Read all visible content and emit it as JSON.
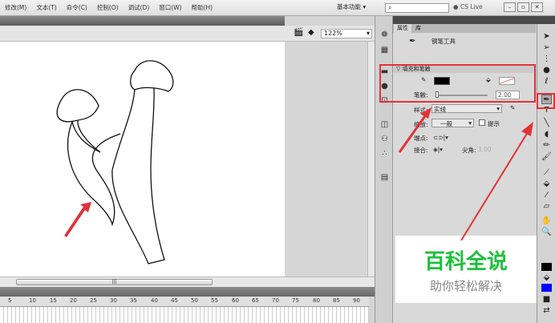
{
  "menu": [
    "修改(M)",
    "文本(T)",
    "命令(C)",
    "控制(O)",
    "调试(D)",
    "窗口(W)",
    "帮助(H)"
  ],
  "workspace": "基本功能 ▾",
  "search_placeholder": "",
  "cs_live": "CS Live",
  "zoom": "122%",
  "timeline_ticks": [
    "5",
    "10",
    "15",
    "20",
    "25",
    "30",
    "35",
    "40",
    "45",
    "50",
    "55",
    "60",
    "65",
    "70",
    "75",
    "80",
    "85",
    "90"
  ],
  "panel": {
    "tabs": [
      "属性",
      "库"
    ],
    "tool_name": "钢笔工具",
    "section": "填充和笔触",
    "stroke_label": "笔触:",
    "stroke_value": "2.00",
    "style_label": "样式:",
    "style_value": "实线",
    "scale_label": "缩放:",
    "scale_value": "一般",
    "hint_label": "提示",
    "cap_label": "端点:",
    "join_label": "接合:",
    "miter_label": "尖角:",
    "miter_value": "3.00",
    "stroke_color": "#000000"
  },
  "watermark": {
    "title": "百科全说",
    "subtitle": "助你轻松解决"
  },
  "colors": {
    "highlight": "#e0333a",
    "brand_green": "#1ec03c",
    "fill_color": "#0000ff"
  }
}
